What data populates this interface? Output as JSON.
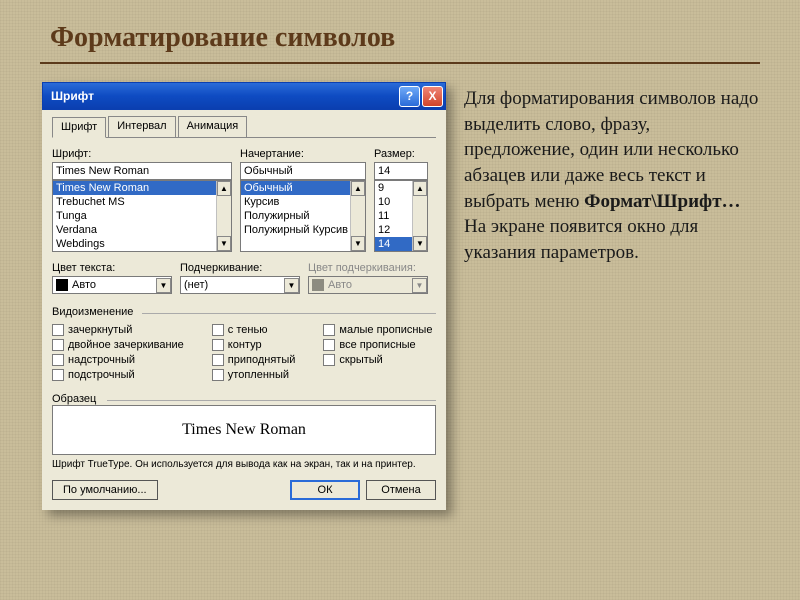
{
  "page": {
    "title": "Форматирование символов"
  },
  "paragraph": {
    "line1": "Для форматирования символов надо выделить слово, фразу, предложение, один или несколько абзацев или даже весь текст и выбрать меню ",
    "bold": "Формат\\Шрифт…",
    "line2": " На экране появится окно для указания параметров."
  },
  "window": {
    "title": "Шрифт",
    "help": "?",
    "close": "X"
  },
  "tabs": {
    "t0": "Шрифт",
    "t1": "Интервал",
    "t2": "Анимация"
  },
  "font": {
    "label": "Шрифт:",
    "value": "Times New Roman",
    "items": {
      "i0": "Times New Roman",
      "i1": "Trebuchet MS",
      "i2": "Tunga",
      "i3": "Verdana",
      "i4": "Webdings"
    }
  },
  "style": {
    "label": "Начертание:",
    "value": "Обычный",
    "items": {
      "i0": "Обычный",
      "i1": "Курсив",
      "i2": "Полужирный",
      "i3": "Полужирный Курсив"
    }
  },
  "size": {
    "label": "Размер:",
    "value": "14",
    "items": {
      "i0": "9",
      "i1": "10",
      "i2": "11",
      "i3": "12",
      "i4": "14"
    }
  },
  "colors": {
    "text_label": "Цвет текста:",
    "text_value": "Авто",
    "underline_label": "Подчеркивание:",
    "underline_value": "(нет)",
    "underline_color_label": "Цвет подчеркивания:",
    "underline_color_value": "Авто"
  },
  "effects": {
    "title": "Видоизменение",
    "col0": {
      "c0": "зачеркнутый",
      "c1": "двойное зачеркивание",
      "c2": "надстрочный",
      "c3": "подстрочный"
    },
    "col1": {
      "c0": "с тенью",
      "c1": "контур",
      "c2": "приподнятый",
      "c3": "утопленный"
    },
    "col2": {
      "c0": "малые прописные",
      "c1": "все прописные",
      "c2": "скрытый"
    }
  },
  "preview": {
    "title": "Образец",
    "sample": "Times New Roman",
    "hint": "Шрифт TrueType. Он используется для вывода как на экран, так и на принтер."
  },
  "buttons": {
    "default_btn": "По умолчанию...",
    "ok": "ОК",
    "cancel": "Отмена"
  }
}
